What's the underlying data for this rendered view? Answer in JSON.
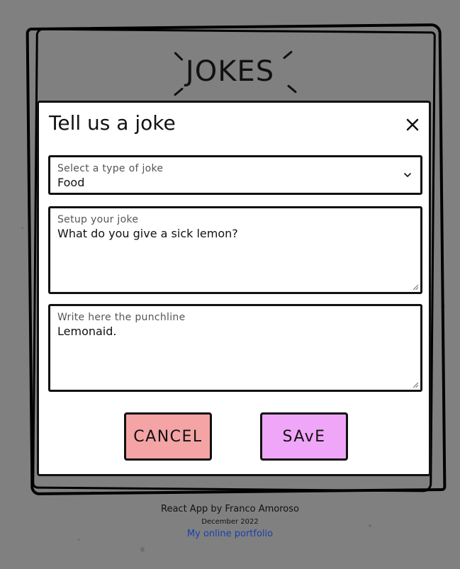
{
  "app": {
    "title": "JOKES"
  },
  "modal": {
    "title": "Tell us a joke",
    "close_icon": "close-icon",
    "type_select": {
      "label": "Select a type of joke",
      "value": "Food"
    },
    "setup": {
      "label": "Setup your joke",
      "value": "What do you give a sick lemon?"
    },
    "punchline": {
      "label": "Write here the punchline",
      "value": "Lemonaid."
    },
    "cancel_label": "CANCEL",
    "save_label": "SAvE"
  },
  "footer": {
    "credit": "React App by Franco Amoroso",
    "date": "December 2022",
    "portfolio_link": "My online portfolio"
  },
  "colors": {
    "background": "#808080",
    "cancel": "#f4a4a4",
    "save": "#f0a6f8",
    "link": "#1a3fb0"
  }
}
